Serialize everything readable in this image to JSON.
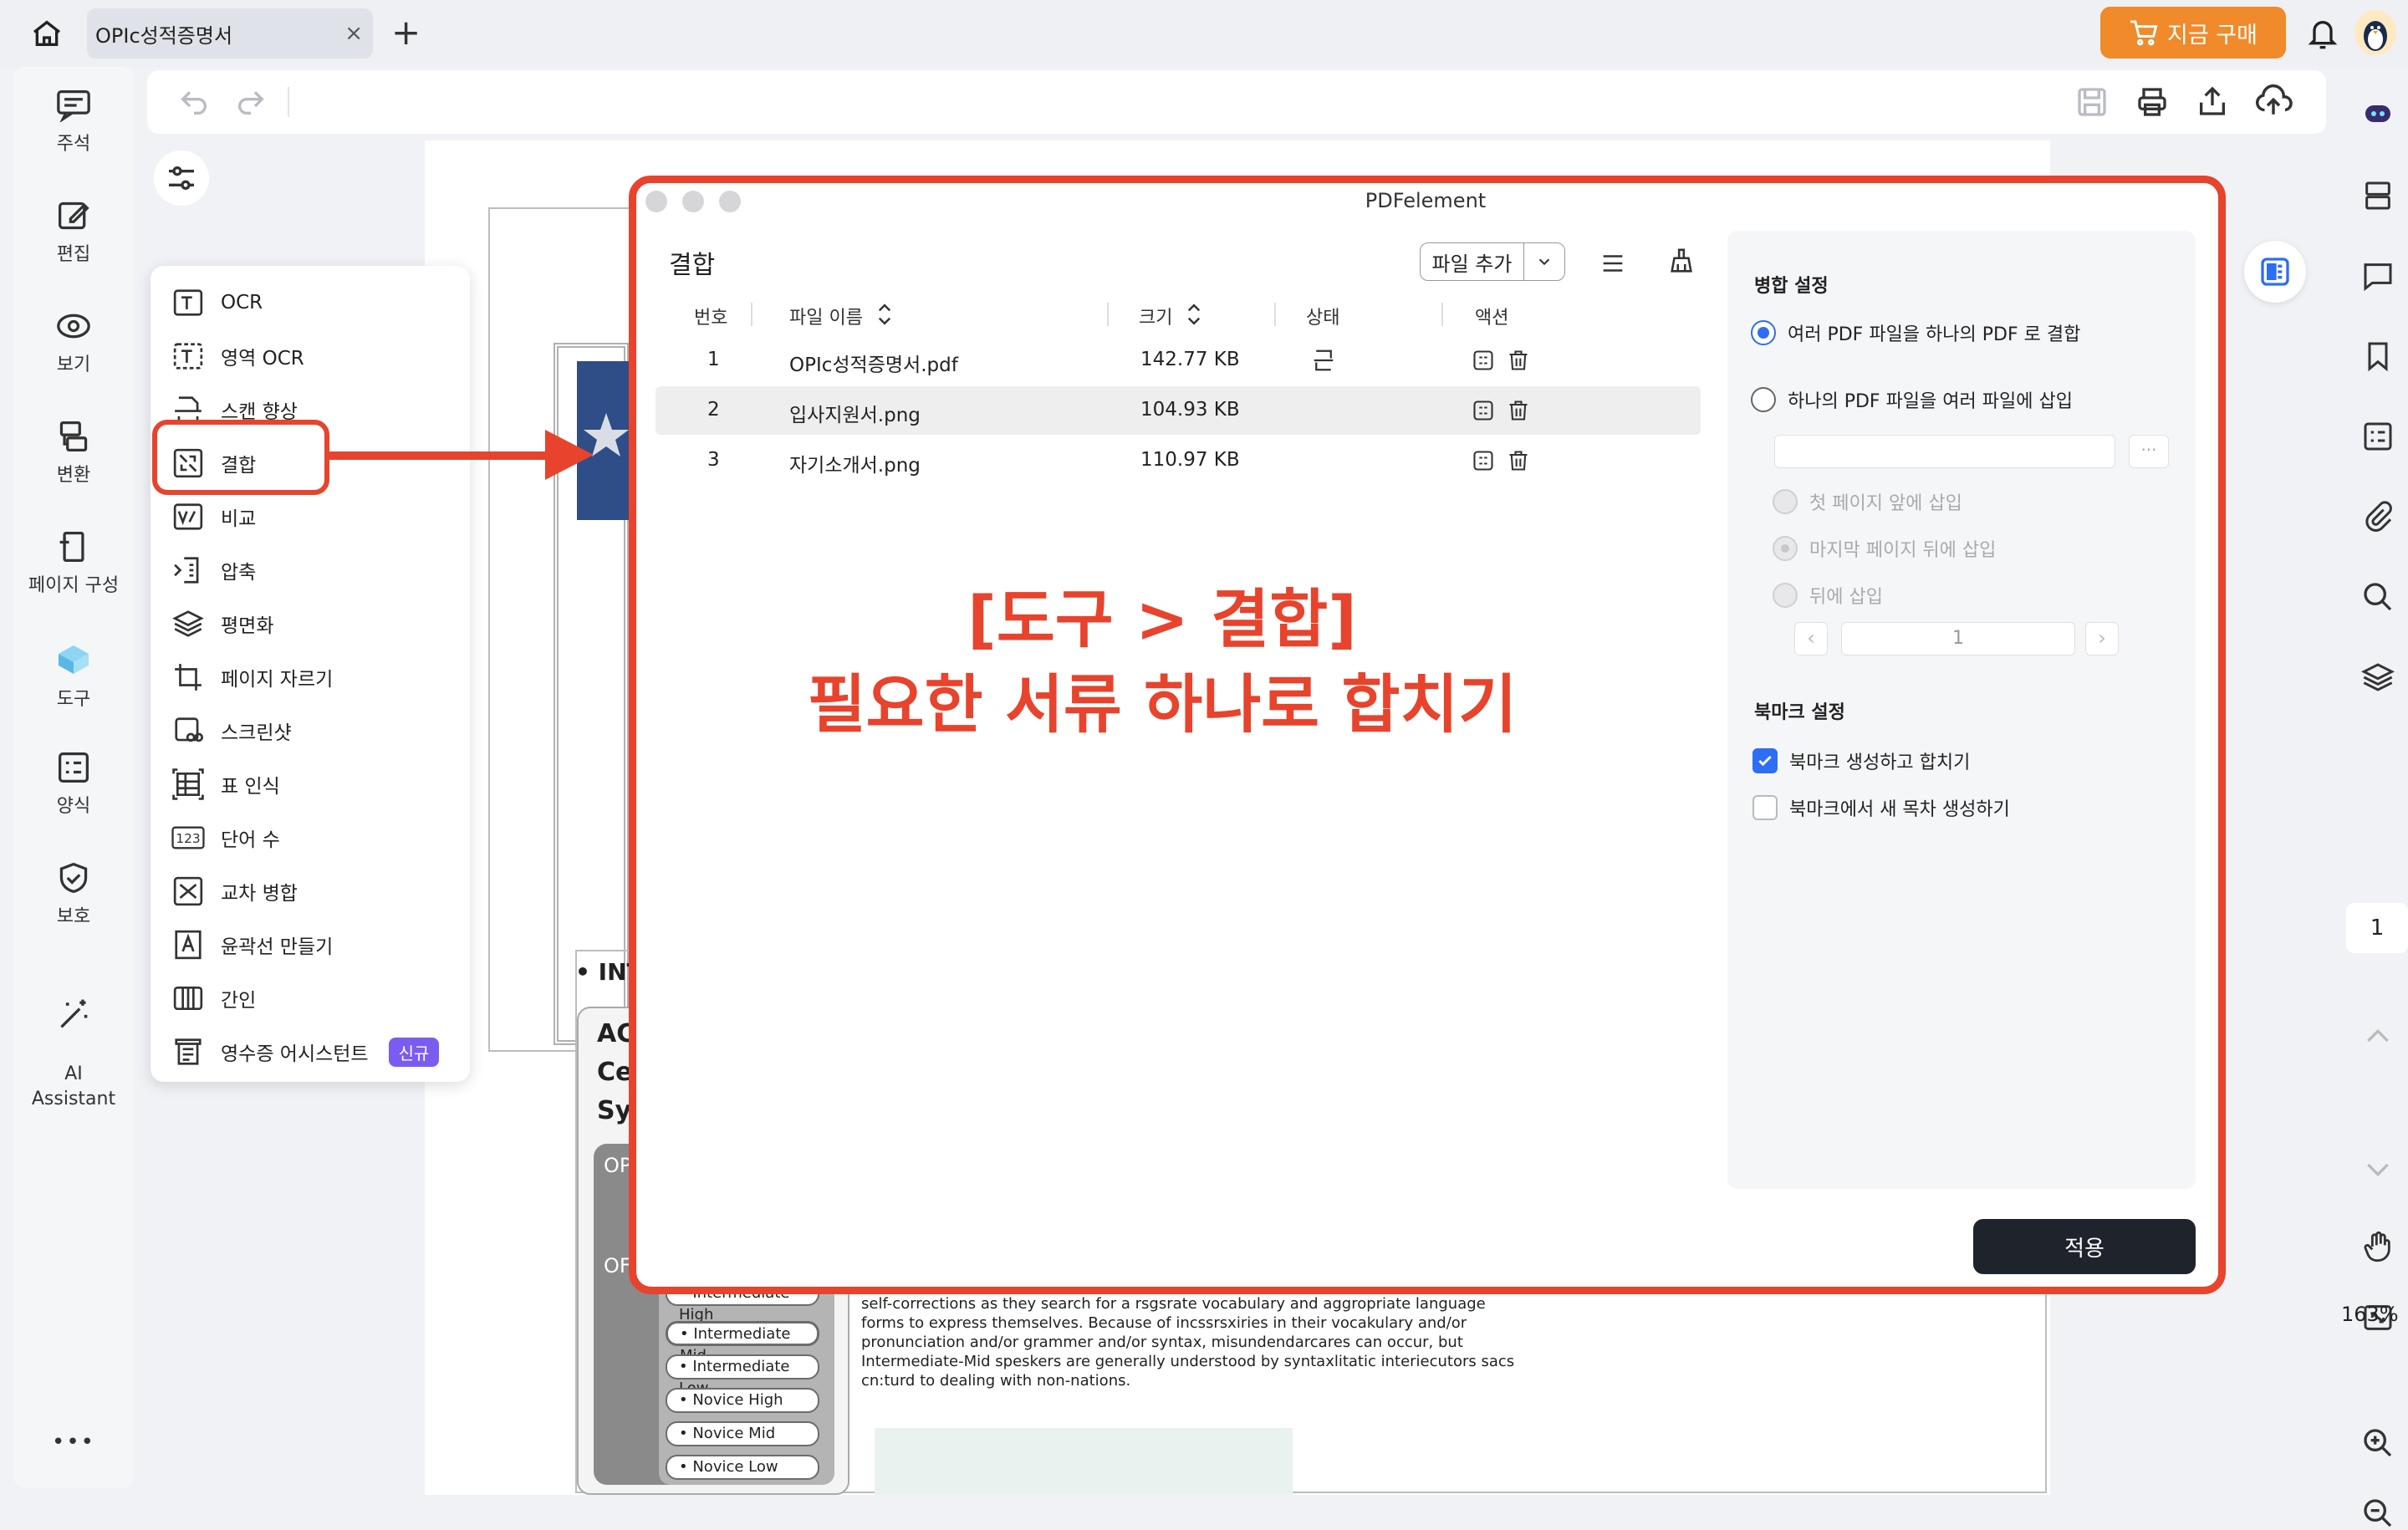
{
  "tab": {
    "title": "OPIc성적증명서",
    "close": "×",
    "add": "+"
  },
  "header": {
    "buy_label": "지금 구매"
  },
  "left_rail": {
    "items": [
      {
        "label": "주석"
      },
      {
        "label": "편집"
      },
      {
        "label": "보기"
      },
      {
        "label": "변환"
      },
      {
        "label": "페이지 구성"
      },
      {
        "label": "도구"
      },
      {
        "label": "양식"
      },
      {
        "label": "보호"
      },
      {
        "label": "AI\nAssistant"
      }
    ],
    "more": "•••"
  },
  "tools_menu": {
    "items": [
      {
        "label": "OCR"
      },
      {
        "label": "영역 OCR"
      },
      {
        "label": "스캔 향상"
      },
      {
        "label": "결합"
      },
      {
        "label": "비교"
      },
      {
        "label": "압축"
      },
      {
        "label": "평면화"
      },
      {
        "label": "페이지 자르기"
      },
      {
        "label": "스크린샷"
      },
      {
        "label": "표 인식"
      },
      {
        "label": "단어 수"
      },
      {
        "label": "교차 병합"
      },
      {
        "label": "윤곽선 만들기"
      },
      {
        "label": "간인"
      },
      {
        "label": "영수증 어시스턴트"
      }
    ],
    "new_badge": "신규"
  },
  "dialog": {
    "window_title": "PDFelement",
    "panel_title": "결합",
    "add_file_label": "파일 추가",
    "columns": {
      "no": "번호",
      "name": "파일 이름",
      "size": "크기",
      "status": "상태",
      "action": "액션"
    },
    "rows": [
      {
        "no": "1",
        "name": "OPIc성적증명서.pdf",
        "size": "142.77 KB"
      },
      {
        "no": "2",
        "name": "입사지원서.png",
        "size": "104.93 KB"
      },
      {
        "no": "3",
        "name": "자기소개서.png",
        "size": "110.97 KB"
      }
    ],
    "overlay_line1": "[도구 > 결합]",
    "overlay_line2": "필요한 서류 하나로 합치기",
    "settings": {
      "merge_heading": "병합 설정",
      "option_merge": "여러 PDF 파일을 하나의 PDF 로 결합",
      "option_insert": "하나의 PDF 파일을 여러 파일에 삽입",
      "path_more": "···",
      "insert_first": "첫 페이지 앞에 삽입",
      "insert_last": "마지막 페이지 뒤에 삽입",
      "insert_after": "뒤에 삽입",
      "page_value": "1",
      "bookmark_heading": "북마크 설정",
      "bookmark_create": "북마크 생성하고 합치기",
      "bookmark_toc": "북마크에서 새 목차 생성하기"
    },
    "apply_label": "적용"
  },
  "doc": {
    "intro": "• INT",
    "ac": "AC\nCe\nSys",
    "op1": "OP",
    "op2": "OF",
    "levels": [
      "• Intermediate High",
      "• Intermediate Mid",
      "• Intermediate Low",
      "• Novice High",
      "• Novice Mid",
      "• Novice Low"
    ],
    "body_text": "self-corrections as they search for a rsgsrate vocabulary and aggropriate language forms to express themselves.  Because of incssrsxiries in their vocakulary and/or pronunciation and/or grammer and/or syntax, misundendarcares can occur, but Intermediate-Mid speskers are generally understood by syntaxlitatic interiecutors sacs cn:turd to dealing with non-nations."
  },
  "right_rail": {
    "page_number": "1",
    "zoom": "163%"
  },
  "colors": {
    "accent_red": "#e8432c",
    "buy_orange": "#f08a2a",
    "blue": "#2d6ef5",
    "apply_dark": "#1f232b",
    "badge_purple": "#7b5cf0"
  }
}
